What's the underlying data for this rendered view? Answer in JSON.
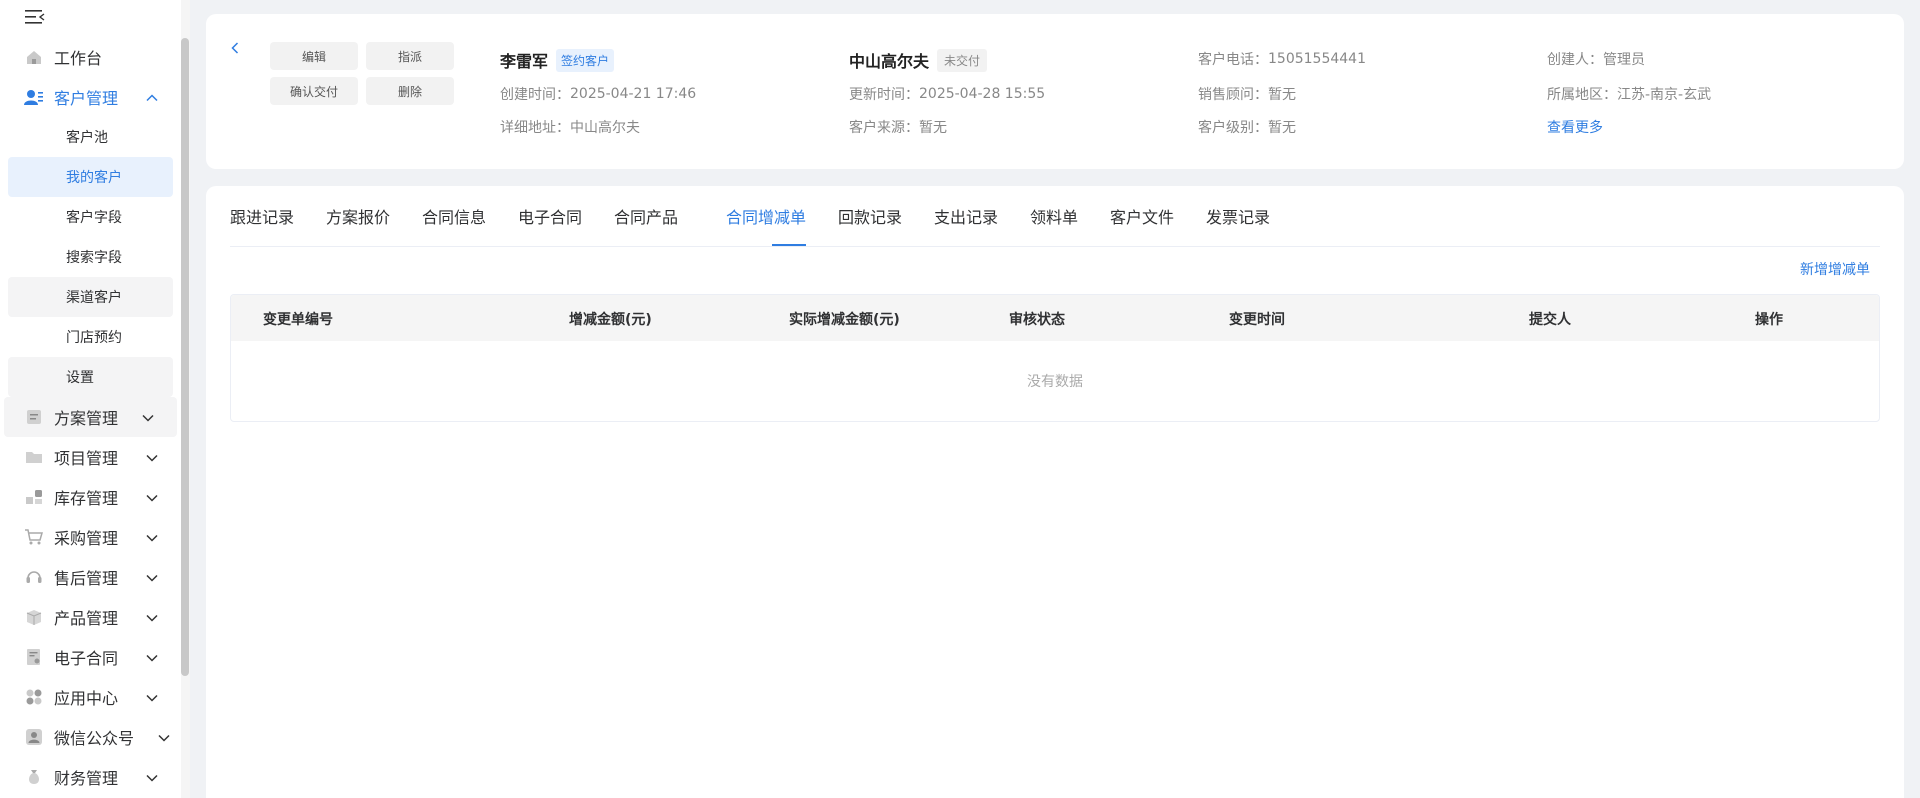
{
  "sidebar": {
    "items": [
      {
        "label": "工作台",
        "icon": "home-icon"
      },
      {
        "label": "客户管理",
        "icon": "customer-icon",
        "expanded": true,
        "children": [
          {
            "label": "客户池"
          },
          {
            "label": "我的客户",
            "active": true
          },
          {
            "label": "客户字段"
          },
          {
            "label": "搜索字段"
          },
          {
            "label": "渠道客户"
          },
          {
            "label": "门店预约"
          },
          {
            "label": "设置"
          }
        ]
      },
      {
        "label": "方案管理",
        "icon": "document-icon"
      },
      {
        "label": "项目管理",
        "icon": "folder-icon"
      },
      {
        "label": "库存管理",
        "icon": "inventory-icon"
      },
      {
        "label": "采购管理",
        "icon": "cart-icon"
      },
      {
        "label": "售后管理",
        "icon": "headset-icon"
      },
      {
        "label": "产品管理",
        "icon": "box-icon"
      },
      {
        "label": "电子合同",
        "icon": "contract-icon"
      },
      {
        "label": "应用中心",
        "icon": "apps-icon"
      },
      {
        "label": "微信公众号",
        "icon": "wechat-user-icon"
      },
      {
        "label": "财务管理",
        "icon": "money-bag-icon"
      }
    ]
  },
  "header": {
    "buttons": {
      "edit": "编辑",
      "assign": "指派",
      "confirm_delivery": "确认交付",
      "delete": "删除"
    },
    "customer_name": "李雷军",
    "customer_tag": "签约客户",
    "project_name": "中山高尔夫",
    "project_tag": "未交付",
    "created_time_label": "创建时间：",
    "created_time": "2025-04-21 17:46",
    "address_label": "详细地址：",
    "address": "中山高尔夫",
    "updated_time_label": "更新时间：",
    "updated_time": "2025-04-28 15:55",
    "source_label": "客户来源：",
    "source": "暂无",
    "phone_label": "客户电话：",
    "phone": "15051554441",
    "sales_label": "销售顾问：",
    "sales": "暂无",
    "level_label": "客户级别：",
    "level": "暂无",
    "creator_label": "创建人：",
    "creator": "管理员",
    "region_label": "所属地区：",
    "region": "江苏-南京-玄武",
    "more": "查看更多"
  },
  "tabs": [
    "跟进记录",
    "方案报价",
    "合同信息",
    "电子合同",
    "合同产品",
    "合同增减单",
    "回款记录",
    "支出记录",
    "领料单",
    "客户文件",
    "发票记录"
  ],
  "active_tab": "合同增减单",
  "table": {
    "add_label": "新增增减单",
    "columns": [
      "变更单编号",
      "增减金额(元)",
      "实际增减金额(元)",
      "审核状态",
      "变更时间",
      "提交人",
      "操作"
    ],
    "empty_text": "没有数据"
  },
  "colors": {
    "accent": "#2f7de1",
    "tag_bg": "#e8f1fd"
  }
}
